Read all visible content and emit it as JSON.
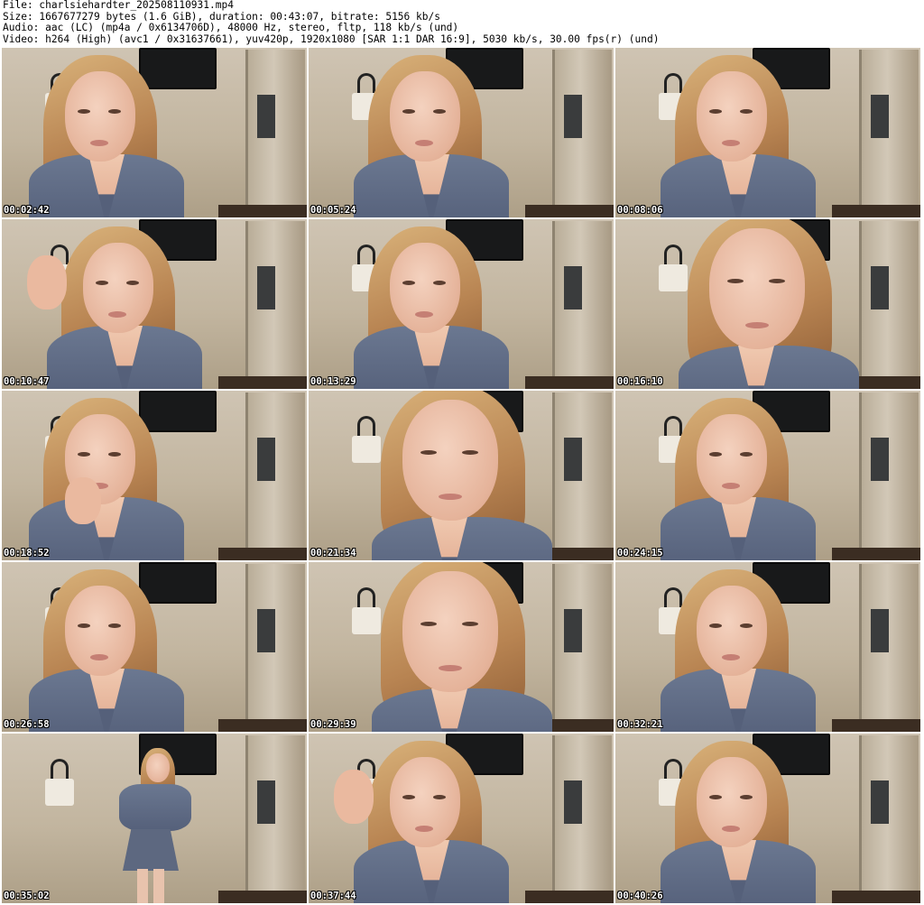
{
  "header": {
    "file": "File: charlsiehardter_202508110931.mp4",
    "size": "Size: 1667677279 bytes (1.6 GiB), duration: 00:43:07, bitrate: 5156 kb/s",
    "audio": "Audio: aac (LC) (mp4a / 0x6134706D), 48000 Hz, stereo, fltp, 118 kb/s (und)",
    "video": "Video: h264 (High) (avc1 / 0x31637661), yuv420p, 1920x1080 [SAR 1:1 DAR 16:9], 5030 kb/s, 30.00 fps(r) (und)"
  },
  "thumbnails": [
    {
      "timestamp": "00:02:42",
      "pose": "left"
    },
    {
      "timestamp": "00:05:24",
      "pose": "center"
    },
    {
      "timestamp": "00:08:06",
      "pose": "center"
    },
    {
      "timestamp": "00:10:47",
      "pose": "hand-hair"
    },
    {
      "timestamp": "00:13:29",
      "pose": "center"
    },
    {
      "timestamp": "00:16:10",
      "pose": "close"
    },
    {
      "timestamp": "00:18:52",
      "pose": "hand-chin"
    },
    {
      "timestamp": "00:21:34",
      "pose": "close"
    },
    {
      "timestamp": "00:24:15",
      "pose": "center"
    },
    {
      "timestamp": "00:26:58",
      "pose": "left"
    },
    {
      "timestamp": "00:29:39",
      "pose": "close"
    },
    {
      "timestamp": "00:32:21",
      "pose": "center"
    },
    {
      "timestamp": "00:35:02",
      "pose": "standing"
    },
    {
      "timestamp": "00:37:44",
      "pose": "hand-hair"
    },
    {
      "timestamp": "00:40:26",
      "pose": "center"
    }
  ]
}
